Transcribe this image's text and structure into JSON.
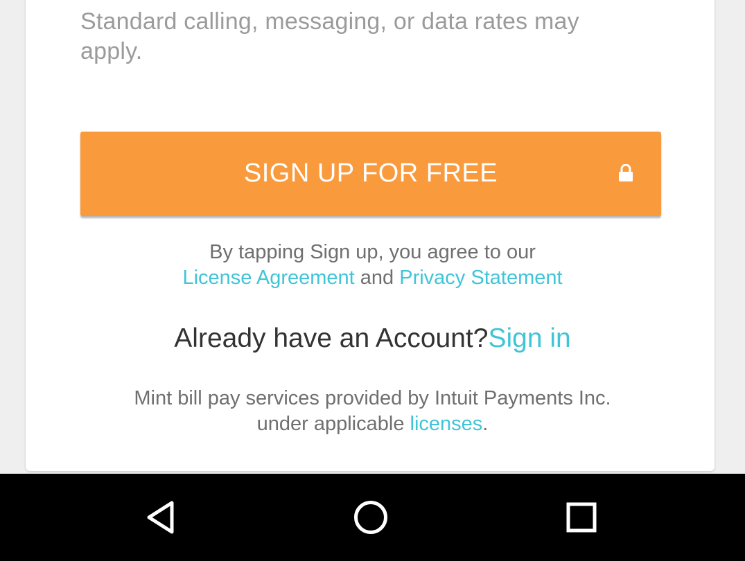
{
  "rates_note": "Standard calling, messaging, or data rates may apply.",
  "signup": {
    "button_label": "SIGN UP FOR FREE",
    "icon": "lock-icon",
    "color": "#f99a3d"
  },
  "agreement": {
    "prefix": "By tapping Sign up, you agree to our",
    "license_link": "License Agreement",
    "conjunction": "and",
    "privacy_link": "Privacy Statement"
  },
  "account": {
    "question": "Already have an Account?",
    "sign_in_link": "Sign in"
  },
  "footer": {
    "line1": "Mint bill pay services provided by Intuit Payments Inc.",
    "line2_prefix": "under applicable",
    "licenses_link": "licenses",
    "line2_suffix": "."
  },
  "colors": {
    "link": "#3fc4d8",
    "muted_text": "#9b9b9b",
    "body_text": "#333333",
    "navbar": "#000000"
  },
  "navbar": {
    "buttons": [
      "back-icon",
      "home-icon",
      "recents-icon"
    ]
  }
}
